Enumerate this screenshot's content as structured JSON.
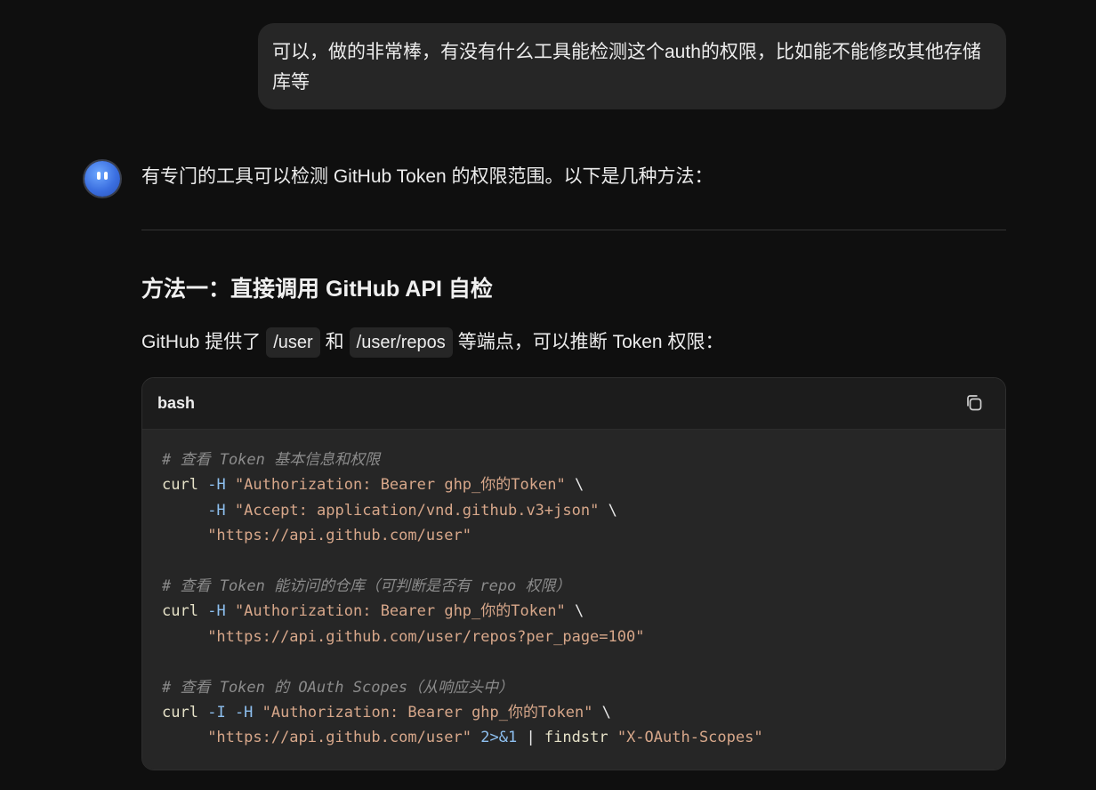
{
  "user_message": "可以，做的非常棒，有没有什么工具能检测这个auth的权限，比如能不能修改其他存储库等",
  "assistant": {
    "intro": "有专门的工具可以检测 GitHub Token 的权限范围。以下是几种方法：",
    "section_heading": "方法一：直接调用 GitHub API 自检",
    "desc_prefix": "GitHub 提供了",
    "code1": "/user",
    "desc_mid": "和",
    "code2": "/user/repos",
    "desc_suffix": "等端点，可以推断 Token 权限："
  },
  "code_block": {
    "language": "bash",
    "copy_icon": "copy-icon",
    "lines": [
      [
        {
          "t": "comment",
          "v": "# 查看 Token 基本信息和权限"
        }
      ],
      [
        {
          "t": "cmd",
          "v": "curl"
        },
        {
          "t": "plain",
          "v": " "
        },
        {
          "t": "flag",
          "v": "-H"
        },
        {
          "t": "plain",
          "v": " "
        },
        {
          "t": "str",
          "v": "\"Authorization: Bearer ghp_你的Token\""
        },
        {
          "t": "plain",
          "v": " \\"
        }
      ],
      [
        {
          "t": "plain",
          "v": "     "
        },
        {
          "t": "flag",
          "v": "-H"
        },
        {
          "t": "plain",
          "v": " "
        },
        {
          "t": "str",
          "v": "\"Accept: application/vnd.github.v3+json\""
        },
        {
          "t": "plain",
          "v": " \\"
        }
      ],
      [
        {
          "t": "plain",
          "v": "     "
        },
        {
          "t": "str",
          "v": "\"https://api.github.com/user\""
        }
      ],
      [],
      [
        {
          "t": "comment",
          "v": "# 查看 Token 能访问的仓库（可判断是否有 repo 权限）"
        }
      ],
      [
        {
          "t": "cmd",
          "v": "curl"
        },
        {
          "t": "plain",
          "v": " "
        },
        {
          "t": "flag",
          "v": "-H"
        },
        {
          "t": "plain",
          "v": " "
        },
        {
          "t": "str",
          "v": "\"Authorization: Bearer ghp_你的Token\""
        },
        {
          "t": "plain",
          "v": " \\"
        }
      ],
      [
        {
          "t": "plain",
          "v": "     "
        },
        {
          "t": "str",
          "v": "\"https://api.github.com/user/repos?per_page=100\""
        }
      ],
      [],
      [
        {
          "t": "comment",
          "v": "# 查看 Token 的 OAuth Scopes（从响应头中）"
        }
      ],
      [
        {
          "t": "cmd",
          "v": "curl"
        },
        {
          "t": "plain",
          "v": " "
        },
        {
          "t": "flag",
          "v": "-I"
        },
        {
          "t": "plain",
          "v": " "
        },
        {
          "t": "flag",
          "v": "-H"
        },
        {
          "t": "plain",
          "v": " "
        },
        {
          "t": "str",
          "v": "\"Authorization: Bearer ghp_你的Token\""
        },
        {
          "t": "plain",
          "v": " \\"
        }
      ],
      [
        {
          "t": "plain",
          "v": "     "
        },
        {
          "t": "str",
          "v": "\"https://api.github.com/user\""
        },
        {
          "t": "plain",
          "v": " "
        },
        {
          "t": "op",
          "v": "2>&1"
        },
        {
          "t": "plain",
          "v": " | "
        },
        {
          "t": "cmd",
          "v": "findstr"
        },
        {
          "t": "plain",
          "v": " "
        },
        {
          "t": "str",
          "v": "\"X-OAuth-Scopes\""
        }
      ]
    ]
  }
}
